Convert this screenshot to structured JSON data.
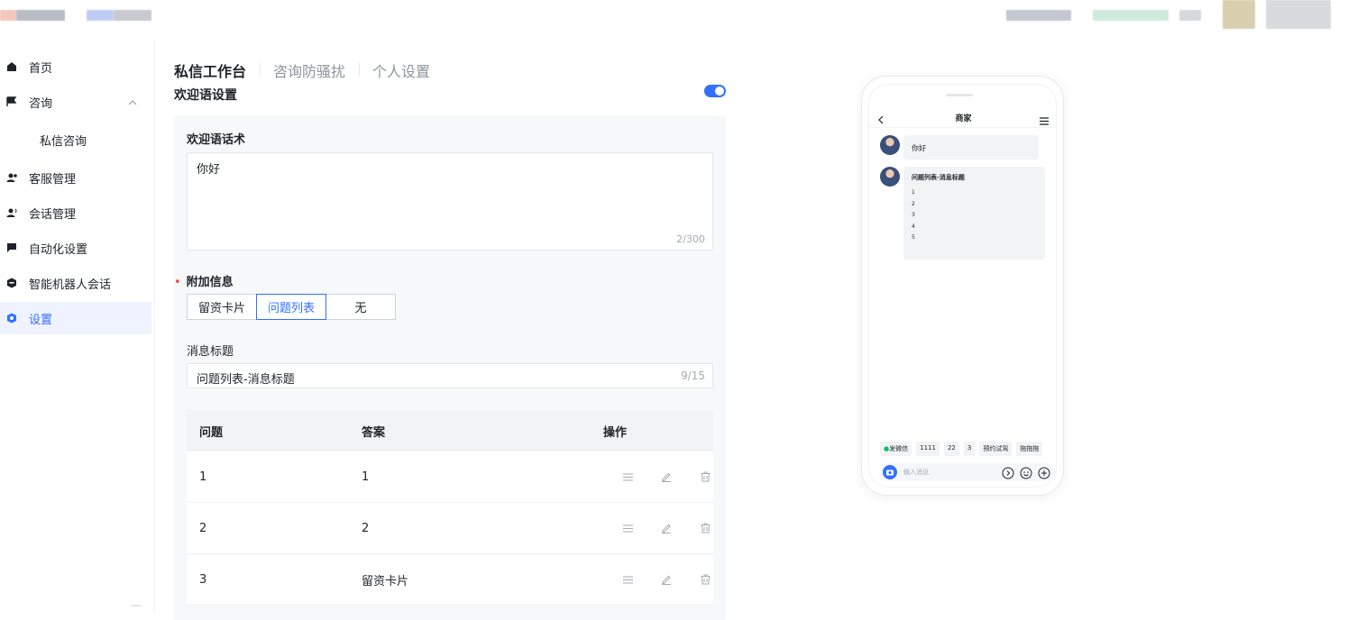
{
  "sidebar": {
    "items": [
      {
        "label": "首页",
        "icon": "home-icon"
      },
      {
        "label": "咨询",
        "icon": "flag-icon",
        "expanded": true
      },
      {
        "label": "私信咨询",
        "icon": ""
      },
      {
        "label": "客服管理",
        "icon": "users-icon"
      },
      {
        "label": "会话管理",
        "icon": "user-voice-icon"
      },
      {
        "label": "自动化设置",
        "icon": "chat-icon"
      },
      {
        "label": "智能机器人会话",
        "icon": "robot-icon"
      },
      {
        "label": "设置",
        "icon": "gear-icon",
        "active": true
      }
    ]
  },
  "tabs": [
    {
      "label": "私信工作台",
      "active": true
    },
    {
      "label": "咨询防骚扰",
      "active": false
    },
    {
      "label": "个人设置",
      "active": false
    }
  ],
  "welcome": {
    "title": "欢迎语设置",
    "enabled": true,
    "script_label": "欢迎语话术",
    "script_value": "你好",
    "script_counter": "2/300",
    "extra_label": "附加信息",
    "extra_options": [
      "留资卡片",
      "问题列表",
      "无"
    ],
    "extra_selected": "问题列表",
    "msg_title_label": "消息标题",
    "msg_title_value": "问题列表-消息标题",
    "msg_title_counter": "9/15"
  },
  "qa_table": {
    "headers": [
      "问题",
      "答案",
      "操作"
    ],
    "rows": [
      {
        "question": "1",
        "answer": "1"
      },
      {
        "question": "2",
        "answer": "2"
      },
      {
        "question": "3",
        "answer": "留资卡片"
      }
    ]
  },
  "preview": {
    "title": "商家",
    "greeting": "你好",
    "list_title": "问题列表-消息标题",
    "list_items": [
      "1",
      "2",
      "3",
      "4",
      "5"
    ],
    "chips": [
      "发微信",
      "1111",
      "22",
      "3",
      "预约试驾",
      "拖拖拖"
    ],
    "input_placeholder": "输入消息"
  },
  "colors": {
    "accent": "#3370ff",
    "active_bg": "#eef3ff",
    "wechat_green": "#07c160"
  }
}
